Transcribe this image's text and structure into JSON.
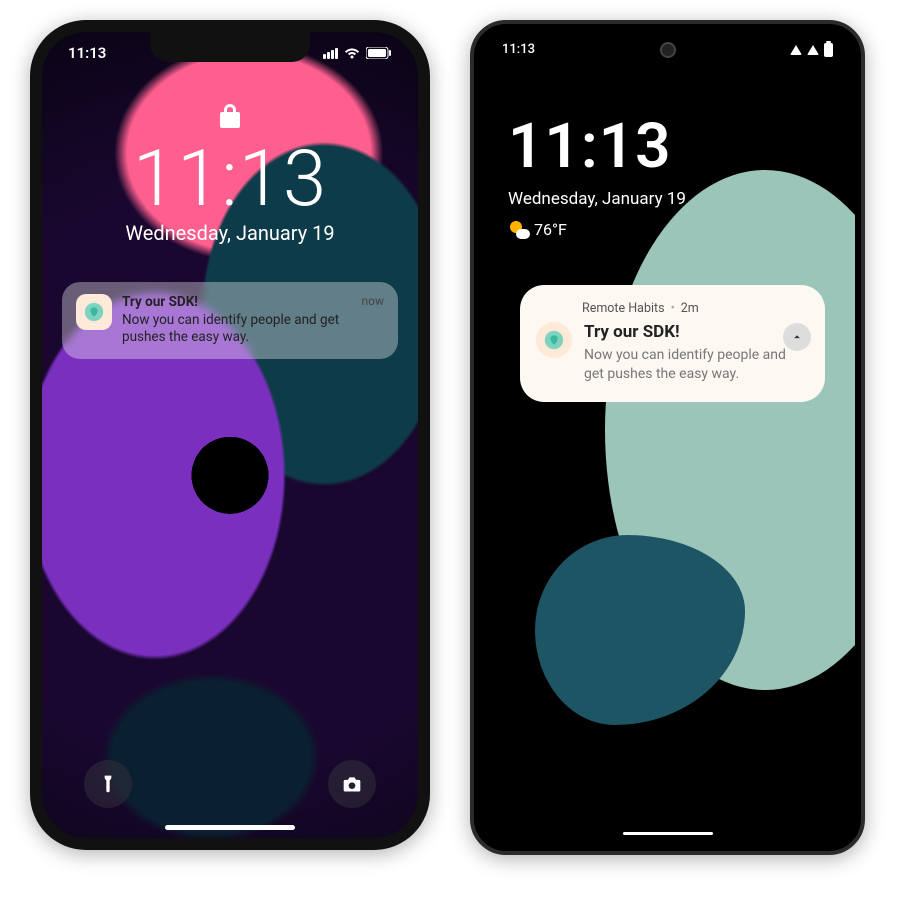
{
  "ios": {
    "status_time": "11:13",
    "time": "11:13",
    "date": "Wednesday, January 19",
    "notification": {
      "title": "Try our SDK!",
      "body": "Now you can identify people and get pushes the easy way.",
      "when": "now"
    }
  },
  "android": {
    "status_time": "11:13",
    "time": "11:13",
    "date": "Wednesday, January 19",
    "temperature": "76°F",
    "notification": {
      "app_name": "Remote Habits",
      "age": "2m",
      "title": "Try our SDK!",
      "body": "Now you can identify people and get pushes the easy way."
    }
  }
}
